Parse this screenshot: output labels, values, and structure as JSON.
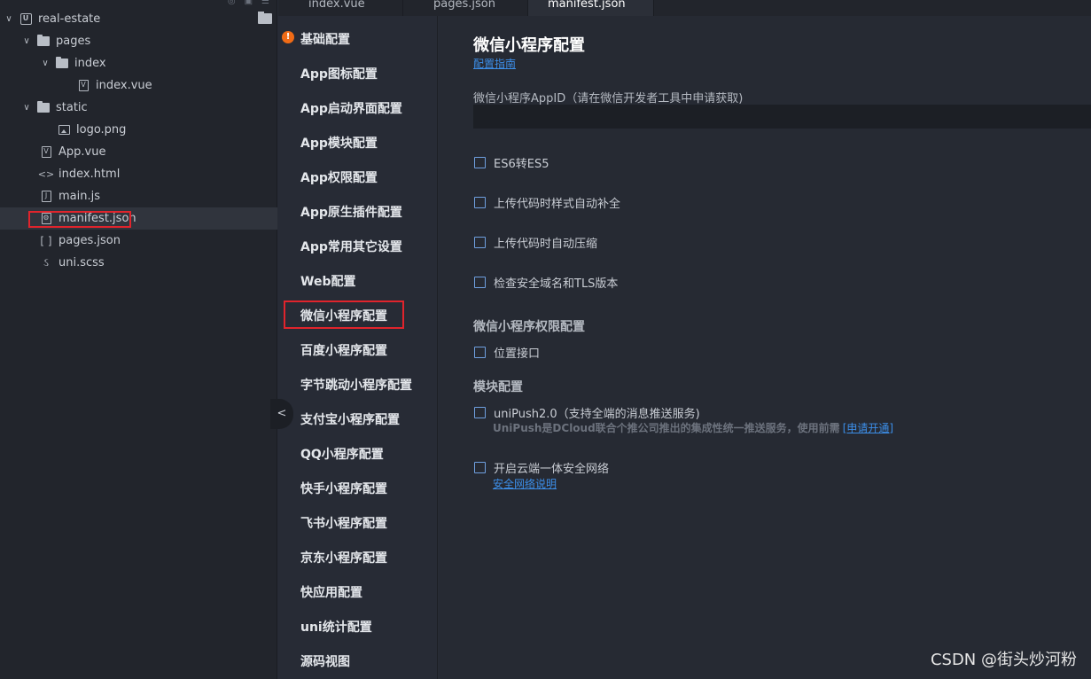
{
  "tabs": [
    "index.vue",
    "pages.json",
    "manifest.json"
  ],
  "active_tab": "manifest.json",
  "tree": {
    "project": "real-estate",
    "items": [
      {
        "label": "pages",
        "type": "folder"
      },
      {
        "label": "index",
        "type": "folder"
      },
      {
        "label": "index.vue",
        "type": "vue"
      },
      {
        "label": "static",
        "type": "folder"
      },
      {
        "label": "logo.png",
        "type": "image"
      },
      {
        "label": "App.vue",
        "type": "vue"
      },
      {
        "label": "index.html",
        "type": "html"
      },
      {
        "label": "main.js",
        "type": "js"
      },
      {
        "label": "manifest.json",
        "type": "json-config",
        "selected": true
      },
      {
        "label": "pages.json",
        "type": "json"
      },
      {
        "label": "uni.scss",
        "type": "scss"
      }
    ]
  },
  "nav": {
    "items": [
      "基础配置",
      "App图标配置",
      "App启动界面配置",
      "App模块配置",
      "App权限配置",
      "App原生插件配置",
      "App常用其它设置",
      "Web配置",
      "微信小程序配置",
      "百度小程序配置",
      "字节跳动小程序配置",
      "支付宝小程序配置",
      "QQ小程序配置",
      "快手小程序配置",
      "飞书小程序配置",
      "京东小程序配置",
      "快应用配置",
      "uni统计配置",
      "源码视图"
    ],
    "selected": "微信小程序配置",
    "warning_item": "基础配置"
  },
  "main": {
    "title": "微信小程序配置",
    "guide_link": "配置指南",
    "appid_label": "微信小程序AppID（请在微信开发者工具中申请获取)",
    "appid_value": "",
    "options": [
      {
        "label": "ES6转ES5",
        "checked": false
      },
      {
        "label": "上传代码时样式自动补全",
        "checked": false
      },
      {
        "label": "上传代码时自动压缩",
        "checked": false
      },
      {
        "label": "检查安全域名和TLS版本",
        "checked": false
      }
    ],
    "permission_section": "微信小程序权限配置",
    "permission_option": "位置接口",
    "module_section": "模块配置",
    "unipush_label": "uniPush2.0（支持全端的消息推送服务)",
    "unipush_desc": "UniPush是DCloud联合个推公司推出的集成性统一推送服务，使用前需",
    "unipush_link": "[申请开通]",
    "cloud_label": "开启云端一体安全网络",
    "cloud_link": "安全网络说明"
  },
  "watermark": "CSDN @街头炒河粉",
  "colors": {
    "background": "#272b35",
    "sidebar": "#22252c",
    "link": "#3c8ee8",
    "highlight_border": "#e0242c",
    "warning": "#f06b16"
  }
}
